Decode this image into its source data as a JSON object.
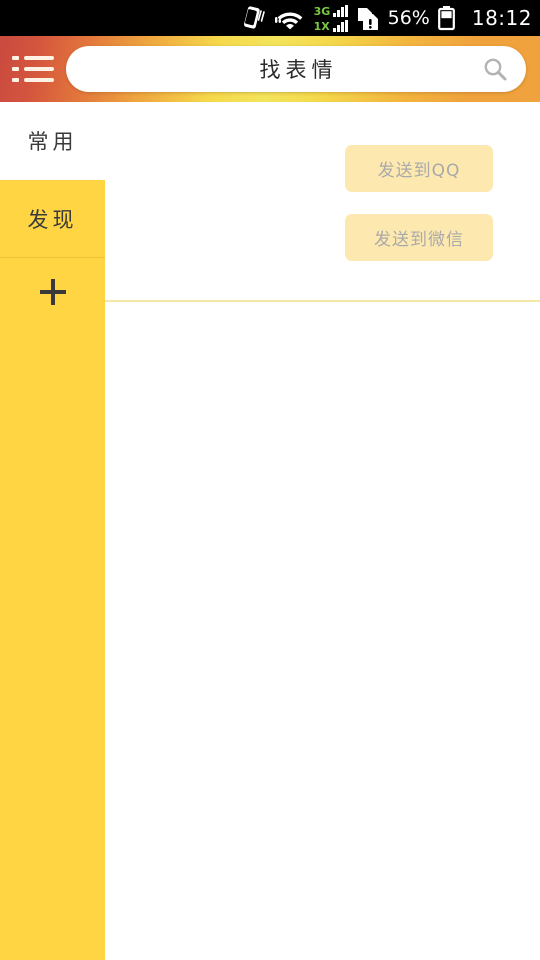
{
  "statusbar": {
    "vibrate_icon": "vibrate-icon",
    "wifi_icon": "wifi-icon",
    "signal": {
      "label_3g": "3G",
      "label_1x": "1X",
      "signal_icon": "signal-bars-icon"
    },
    "sim_alert_icon": "sim-card-alert-icon",
    "battery_percent": "56%",
    "battery_icon": "battery-icon",
    "time": "18:12"
  },
  "header": {
    "menu_icon": "list-menu-icon",
    "search": {
      "value": "找表情",
      "placeholder": "找表情",
      "icon": "search-icon"
    }
  },
  "sidebar": {
    "items": [
      {
        "label": "常用",
        "active": true
      },
      {
        "label": "发现",
        "active": false
      }
    ],
    "add_label": "+",
    "add_icon": "plus-icon",
    "background_color": "#ffd543"
  },
  "content": {
    "actions": [
      {
        "label": "发送到QQ"
      },
      {
        "label": "发送到微信"
      }
    ],
    "divider_color": "#f6e6a8"
  },
  "theme": {
    "accent": "#ffd543",
    "header_start": "#c94a3f",
    "header_mid": "#f3e45c",
    "header_end": "#efa23d",
    "button_bg": "#fde9b0",
    "button_text": "#a9a9a9"
  }
}
